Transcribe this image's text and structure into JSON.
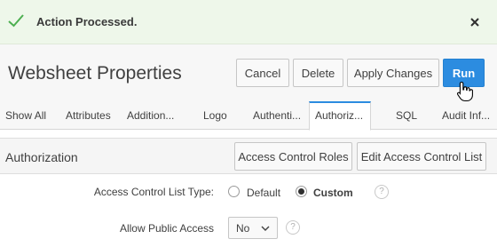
{
  "banner": {
    "message": "Action Processed.",
    "icon": "check-icon",
    "close_icon": "close-icon",
    "background": "#eef7ea",
    "check_color": "#4caf50"
  },
  "header": {
    "title": "Websheet Properties",
    "buttons": {
      "cancel": "Cancel",
      "delete": "Delete",
      "apply": "Apply Changes",
      "run": "Run"
    },
    "accent_color": "#2c8ce0"
  },
  "tabs": [
    {
      "label": "Show All",
      "active": false
    },
    {
      "label": "Attributes",
      "active": false
    },
    {
      "label": "Addition...",
      "active": false
    },
    {
      "label": "Logo",
      "active": false
    },
    {
      "label": "Authenti...",
      "active": false
    },
    {
      "label": "Authoriz...",
      "active": true
    },
    {
      "label": "SQL",
      "active": false
    },
    {
      "label": "Audit Inf...",
      "active": false
    }
  ],
  "region": {
    "title": "Authorization",
    "buttons": {
      "access_control_roles": "Access Control Roles",
      "edit_access_control_list": "Edit Access Control List"
    }
  },
  "form": {
    "acl_type": {
      "label": "Access Control List Type:",
      "options": [
        "Default",
        "Custom"
      ],
      "selected": "Custom",
      "help_icon": "help-icon"
    },
    "public_access": {
      "label": "Allow Public Access",
      "value": "No",
      "help_icon": "help-icon"
    }
  }
}
